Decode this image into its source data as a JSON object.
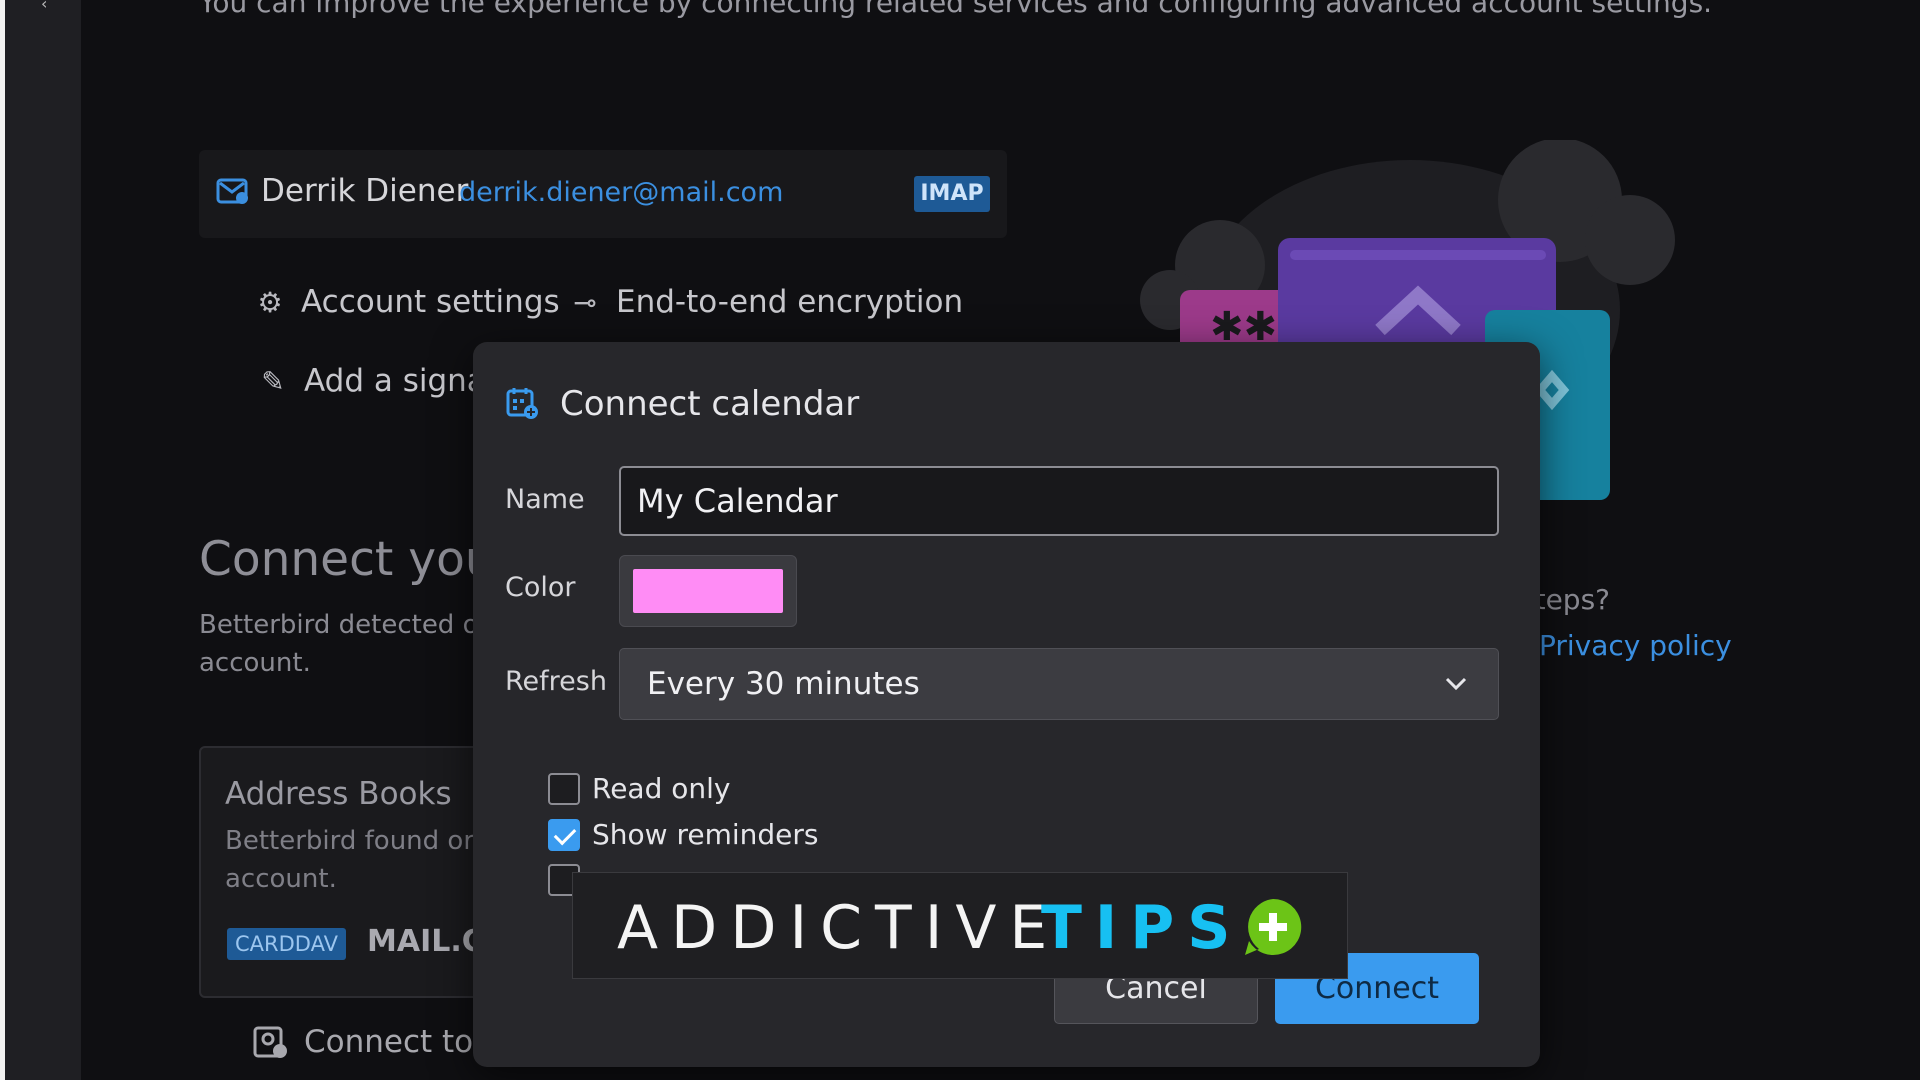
{
  "intro_text": "You can improve the experience by connecting related services and configuring advanced account settings.",
  "account": {
    "name": "Derrik Diener",
    "email": "derrik.diener@mail.com",
    "protocol_badge": "IMAP"
  },
  "account_actions": {
    "settings": "Account settings",
    "encryption": "End-to-end encryption",
    "signature": "Add a signa"
  },
  "connect_section": {
    "heading": "Connect your",
    "description": "Betterbird detected o account.",
    "address_books": {
      "title": "Address Books",
      "description": "Betterbird found or account.",
      "badge": "CARDDAV",
      "server": "MAIL.C"
    },
    "connect_other": "Connect to a"
  },
  "help": {
    "question": "steps?",
    "privacy_link": "Privacy policy"
  },
  "dialog": {
    "title": "Connect calendar",
    "name_label": "Name",
    "name_value": "My Calendar",
    "color_label": "Color",
    "color_value": "#ff8cf5",
    "refresh_label": "Refresh",
    "refresh_value": "Every 30 minutes",
    "checkboxes": [
      {
        "label": "Read only",
        "checked": false
      },
      {
        "label": "Show reminders",
        "checked": true
      },
      {
        "label": "",
        "checked": false
      }
    ],
    "cancel_label": "Cancel",
    "connect_label": "Connect"
  },
  "watermark": {
    "word1": "ADDICTIVE",
    "word2": "TIPS"
  },
  "colors": {
    "accent_blue": "#3a9bef",
    "link_blue": "#3b8fe0",
    "badge_blue": "#1e5a96",
    "watermark_cyan": "#17c0f2",
    "watermark_green": "#6cc417"
  }
}
